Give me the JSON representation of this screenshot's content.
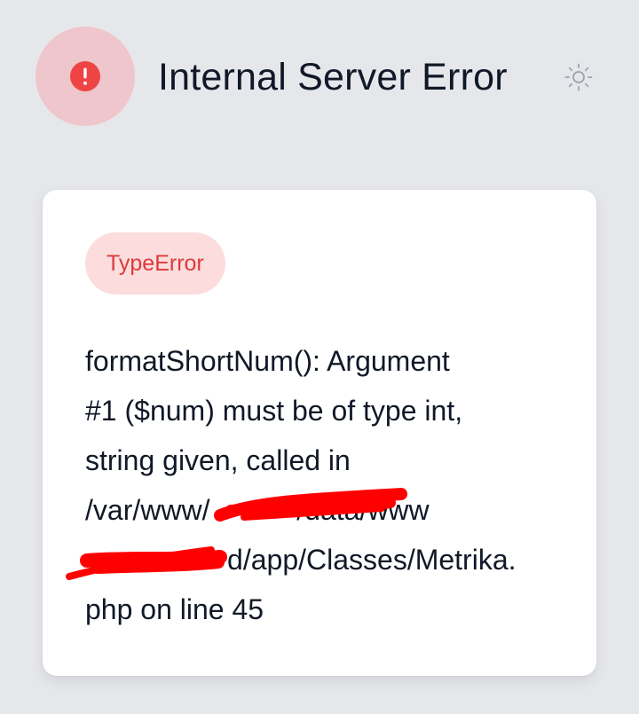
{
  "header": {
    "title": "Internal Server Error",
    "error_icon": "exclamation-circle-icon",
    "theme_toggle_icon": "sun-icon"
  },
  "error": {
    "type": "TypeError",
    "message_lines": [
      "formatShortNum(): Argument",
      "#1 ($num) must be of type int,",
      "string given, called in",
      "/var/www/           /data/www",
      "                  d/app/Classes/Metrika.",
      "php on line 45"
    ]
  },
  "colors": {
    "background": "#e5e7eb",
    "icon_circle": "#efc6cb",
    "icon_dot": "#ef4444",
    "badge_bg": "#fcdcdc",
    "badge_text": "#dc3b3b",
    "redaction": "#ff0000"
  }
}
